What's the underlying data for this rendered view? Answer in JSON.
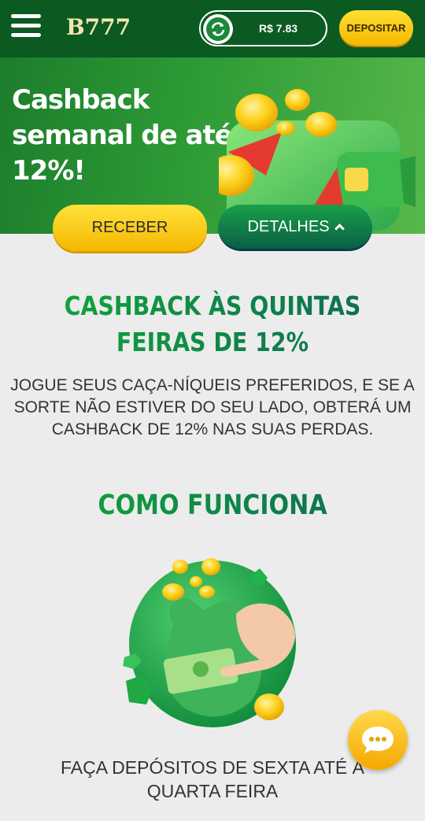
{
  "header": {
    "logo": "B777",
    "balance": "R$  7.83",
    "deposit_label": "DEPOSITAR"
  },
  "banner": {
    "title": "Cashback semanal de até 12%!",
    "receber_label": "RECEBER",
    "detalhes_label": "DETALHES"
  },
  "main": {
    "heading": "CASHBACK ÀS QUINTAS FEIRAS DE 12%",
    "description": "JOGUE SEUS CAÇA-NÍQUEIS PREFERIDOS, E SE A SORTE NÃO ESTIVER DO SEU LADO, OBTERÁ UM CASHBACK DE 12% NAS SUAS PERDAS.",
    "how_heading": "COMO FUNCIONA",
    "step1": "FAÇA DEPÓSITOS DE SEXTA ATÉ À QUARTA FEIRA"
  },
  "colors": {
    "header_bg": "#0a5a22",
    "accent_yellow": "#f6b700",
    "heading_green": "#11a83a"
  }
}
